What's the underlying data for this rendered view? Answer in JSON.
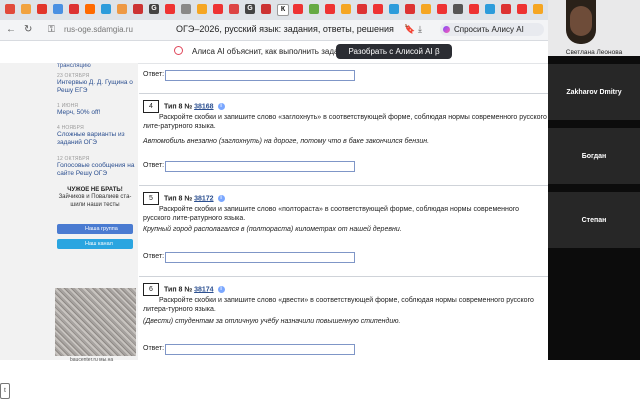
{
  "browser": {
    "url": "rus-oge.sdamgia.ru",
    "title": "ОГЭ–2026, русский язык: задания, ответы, решения",
    "ask_alice": "Спросить Алису AI",
    "tab_letters": [
      "К",
      "G",
      "G"
    ]
  },
  "banner": {
    "text": "Алиса AI объяснит, как выполнить задание",
    "button": "Разобрать с Алисой AI β"
  },
  "sidebar": {
    "cut_text": "трансляцию",
    "news": [
      {
        "date": "23 октября",
        "title": "Интервью Д. Д. Гущина о Решу ЕГЭ"
      },
      {
        "date": "1 июня",
        "title": "Мерч, 50% off!"
      },
      {
        "date": "4 ноября",
        "title": "Сложные варианты из заданий ОГЭ"
      },
      {
        "date": "12 октября",
        "title": "Голосовые сообщения на сайте Решу ОГЭ"
      }
    ],
    "warning_title": "ЧУЖОЕ НЕ БРАТЬ!",
    "warning_text": "Зайчиков и Повалиев ста-шили наши тесты",
    "vk_label": "Наша группа",
    "tg_label": "Наш канал",
    "ad_caption": "baucenter.ru мы.на"
  },
  "main": {
    "answer_label": "Ответ:",
    "tasks": [
      {
        "num": "4",
        "type_label": "Тип 8 №",
        "id": "38168",
        "body": "Раскройте скобки и запишите слово «заглохнуть» в соответствующей форме, соблюдая нормы современного русского лите-ратурного языка.",
        "example": "Автомобиль внезапно (заглохнуть) на дороге, потому что в баке закончился бензин."
      },
      {
        "num": "5",
        "type_label": "Тип 8 №",
        "id": "38172",
        "body": "Раскройте скобки и запишите слово «полтораста» в соответствующей форме, соблюдая нормы современного русского лите-ратурного языка.",
        "example": "Крупный город располагался в (полтораста) километрах от нашей деревни."
      },
      {
        "num": "6",
        "type_label": "Тип 8 №",
        "id": "38174",
        "body": "Раскройте скобки и запишите слово «двести» в соответствующей форме, соблюдая нормы современного русского литера-турного языка.",
        "example": "(Двести) студентам за отличную учёбу назначили повышенную стипендию."
      }
    ]
  },
  "video": {
    "self_name": "Светлана Леонова",
    "participants": [
      "Zakharov Dmitry",
      "Богдан",
      "Степан"
    ]
  },
  "colors": {
    "link": "#2b4f90",
    "alice_button": "#2b2d33",
    "vk": "#4a7bd1",
    "tg": "#2aa5e0"
  }
}
